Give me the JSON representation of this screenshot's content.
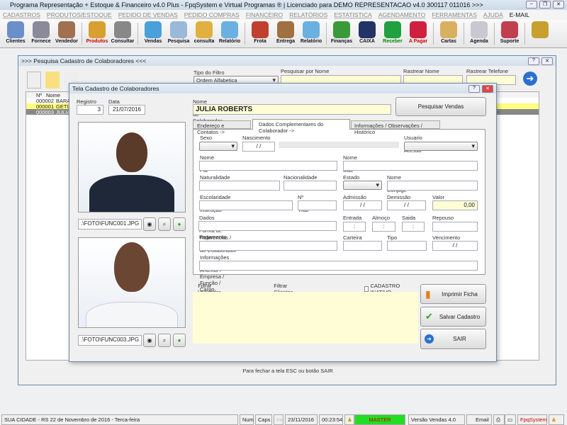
{
  "app": {
    "title": "Programa Representação + Estoque & Financeiro v4.0 Plus - FpqSystem e Virtual Programas ® | Licenciado para  DEMO REPRESENTACAO v4.0 300117 011016 >>>"
  },
  "menu": [
    "CADASTROS",
    "PRODUTOS/ESTOQUE",
    "PEDIDO DE VENDAS",
    "PEDIDO COMPRAS",
    "FINANCEIRO",
    "RELATÓRIOS",
    "ESTATISTICA",
    "AGENDAMENTO",
    "FERRAMENTAS",
    "AJUDA",
    "E-MAIL"
  ],
  "toolbar": [
    {
      "label": "Clientes",
      "color": "#6a8fc9"
    },
    {
      "label": "Fornece",
      "color": "#8a8a9a"
    },
    {
      "label": "Vendedor",
      "color": "#a07050"
    },
    null,
    {
      "label": "Produtos",
      "color": "#d8a030",
      "red": true
    },
    {
      "label": "Consultar",
      "color": "#888"
    },
    null,
    {
      "label": "Vendas",
      "color": "#4aa0d8"
    },
    {
      "label": "Pesquisa",
      "color": "#9ab8d8"
    },
    {
      "label": "consulta",
      "color": "#e0b040"
    },
    {
      "label": "Relatório",
      "color": "#6ab0e0"
    },
    null,
    {
      "label": "Frota",
      "color": "#c04030"
    },
    {
      "label": "Entrega",
      "color": "#a07040"
    },
    {
      "label": "Relatório",
      "color": "#6ab0e0"
    },
    null,
    {
      "label": "Finanças",
      "color": "#3a9a3a"
    },
    {
      "label": "CAIXA",
      "color": "#223366"
    },
    {
      "label": "Receber",
      "color": "#20a040",
      "green": true
    },
    {
      "label": "A Pagar",
      "color": "#d02040",
      "red": true
    },
    null,
    {
      "label": "Cartas",
      "color": "#d8b060"
    },
    null,
    {
      "label": "Agenda",
      "color": "#c8c8d0"
    },
    null,
    {
      "label": "Suporte",
      "color": "#c04050"
    },
    null,
    {
      "label": "",
      "color": "#c8a030"
    }
  ],
  "search_window": {
    "title": ">>> Pesquisa Cadastro de Colaboradores <<<",
    "filter_type_label": "Tipo do Filtro",
    "filter_type_value": "Ordem Alfabetica",
    "search_name_label": "Pesquisar por Nome",
    "track_name_label": "Rastrear Nome",
    "track_phone_label": "Rastrear Telefone",
    "columns": [
      "Nº",
      "Nome"
    ],
    "rows": [
      {
        "num": "000002",
        "name": "BARAC"
      },
      {
        "num": "000001",
        "name": "GETUL"
      },
      {
        "num": "000003",
        "name": "JULIA"
      }
    ]
  },
  "dialog": {
    "title": "Tela Cadastro de Colaboradores",
    "registro_label": "Registro",
    "registro": "3",
    "data_cadastro_label": "Data Cadastro",
    "data_cadastro": "21/07/2016",
    "nome_label": "Nome Completo do Colaborador",
    "nome": "JULIA ROBERTS",
    "pesquisar_vendas": "Pesquisar Vendas",
    "photo1_path": ".\\FOTO\\FUNC001.JPG",
    "photo2_path": ".\\FOTO\\FUNC003.JPG",
    "tabs": [
      "Endereço e Contatos ->",
      "Dados Complementares do Colaborador ->",
      "Informações / Observações / Histórico"
    ],
    "fields": {
      "sexo": "Sexo",
      "nascimento": "Nascimento",
      "nascimento_value": " / /",
      "usuario": "Usuario de Acesso",
      "pai": "Nome do Pai",
      "mae": "Nome da Mãe",
      "naturalidade": "Naturalidade",
      "nacionalidade": "Nacionalidade",
      "estado_civil": "Estado Civil",
      "conjuge": "Nome do Cônjuge",
      "escolaridade": "Escolaridade / Grau de Instrução",
      "carteira_trab": "Nº Carteira Trab",
      "admissao": "Admissão",
      "admissao_value": " / /",
      "demissao": "Demissão",
      "demissao_value": " / /",
      "salario": "Valor Salário",
      "salario_value": "0,00",
      "bancarios": "Dados Bancários / Forma de Pagamento",
      "entrada": "Entrada",
      "entrada_value": ":",
      "almoco": "Almoço",
      "almoco_value": ":",
      "saida": "Saida",
      "saida_value": ":",
      "repouso": "Repouso",
      "referencias": "Referencias / Caractereisticas do Colaborador",
      "carteira_motorista": "Carteira Motorista",
      "tipo_carteira": "Tipo Carteira",
      "vencimento": "Vencimento",
      "vencimento_value": " / /",
      "trabalho_anterior": "Informações do Trabalho Anterior / Empresa / Função / Cargo"
    },
    "radio_vendedor": "Filtrar Vendedor nas Pesquisas",
    "radio_clientes": "Filtrar Clientes na Pesquisa",
    "inativo": "CADASTRO INATIVO",
    "imprimir": "Imprimir Ficha",
    "salvar": "Salvar Cadastro",
    "sair": "SAIR"
  },
  "footer_hint": "Para fechar a tela ESC ou botão SAIR",
  "status": {
    "city": "SUA CIDADE - RS 22 de Novembro de 2016 - Terca-feira",
    "num": "Num",
    "caps": "Caps",
    "ins": "Ins",
    "date": "23/11/2016",
    "time": "00:23:54",
    "user": "MASTER",
    "version": "Versão Vendas 4.0",
    "email": "Email",
    "brand": "FpqSystem"
  },
  "colors": {
    "user_badge": "#22dd22",
    "input_yellow": "#fffdd6",
    "selected_row": "#ffff80"
  }
}
